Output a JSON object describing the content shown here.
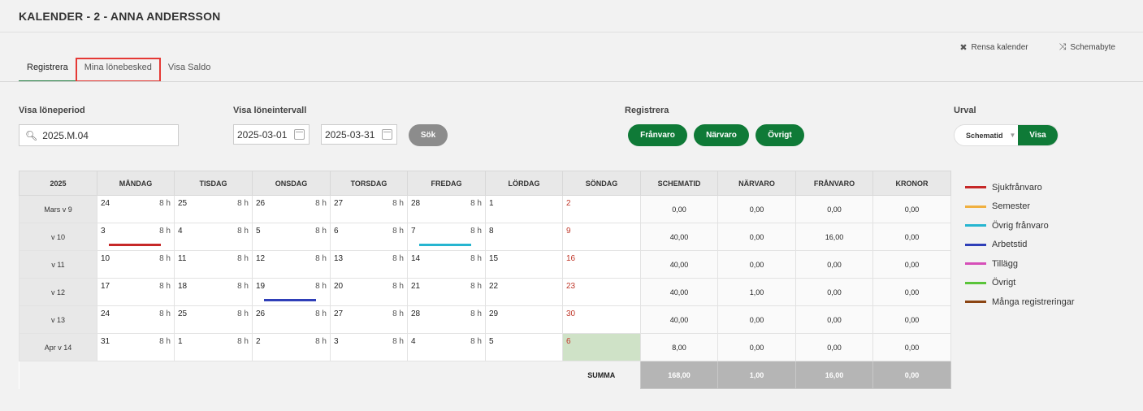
{
  "header": {
    "title": "KALENDER - 2 - ANNA ANDERSSON"
  },
  "top_actions": [
    {
      "icon": "close-icon",
      "glyph": "✖",
      "label": "Rensa kalender"
    },
    {
      "icon": "shuffle-icon",
      "glyph": "⤨",
      "label": "Schemabyte"
    }
  ],
  "tabs": [
    {
      "label": "Registrera",
      "active": true
    },
    {
      "label": "Mina lönebesked",
      "highlighted": true
    },
    {
      "label": "Visa Saldo"
    }
  ],
  "filters": {
    "period_label": "Visa löneperiod",
    "period_value": "2025.M.04",
    "interval_label": "Visa löneintervall",
    "date_from": "2025-03-01",
    "date_to": "2025-03-31",
    "search_button": "Sök",
    "register_label": "Registrera",
    "register_buttons": [
      "Frånvaro",
      "Närvaro",
      "Övrigt"
    ],
    "urval_label": "Urval",
    "urval_select": "Schematid",
    "urval_button": "Visa"
  },
  "calendar": {
    "year": "2025",
    "day_headers": [
      "MÅNDAG",
      "TISDAG",
      "ONSDAG",
      "TORSDAG",
      "FREDAG",
      "LÖRDAG",
      "SÖNDAG"
    ],
    "sum_headers": [
      "SCHEMATID",
      "NÄRVARO",
      "FRÅNVARO",
      "KRONOR"
    ],
    "weeks": [
      {
        "label": "Mars v 9",
        "days": [
          {
            "d": "24",
            "h": "8 h"
          },
          {
            "d": "25",
            "h": "8 h"
          },
          {
            "d": "26",
            "h": "8 h"
          },
          {
            "d": "27",
            "h": "8 h"
          },
          {
            "d": "28",
            "h": "8 h"
          },
          {
            "d": "1",
            "h": ""
          },
          {
            "d": "2",
            "h": ""
          }
        ],
        "sums": [
          "0,00",
          "0,00",
          "0,00",
          "0,00"
        ]
      },
      {
        "label": "v 10",
        "days": [
          {
            "d": "3",
            "h": "8 h",
            "mark": "#c62828"
          },
          {
            "d": "4",
            "h": "8 h"
          },
          {
            "d": "5",
            "h": "8 h"
          },
          {
            "d": "6",
            "h": "8 h"
          },
          {
            "d": "7",
            "h": "8 h",
            "mark": "#26b5d0"
          },
          {
            "d": "8",
            "h": ""
          },
          {
            "d": "9",
            "h": ""
          }
        ],
        "sums": [
          "40,00",
          "0,00",
          "16,00",
          "0,00"
        ]
      },
      {
        "label": "v 11",
        "days": [
          {
            "d": "10",
            "h": "8 h"
          },
          {
            "d": "11",
            "h": "8 h"
          },
          {
            "d": "12",
            "h": "8 h"
          },
          {
            "d": "13",
            "h": "8 h"
          },
          {
            "d": "14",
            "h": "8 h"
          },
          {
            "d": "15",
            "h": ""
          },
          {
            "d": "16",
            "h": ""
          }
        ],
        "sums": [
          "40,00",
          "0,00",
          "0,00",
          "0,00"
        ]
      },
      {
        "label": "v 12",
        "days": [
          {
            "d": "17",
            "h": "8 h"
          },
          {
            "d": "18",
            "h": "8 h"
          },
          {
            "d": "19",
            "h": "8 h",
            "mark": "#2f3fb8"
          },
          {
            "d": "20",
            "h": "8 h"
          },
          {
            "d": "21",
            "h": "8 h"
          },
          {
            "d": "22",
            "h": ""
          },
          {
            "d": "23",
            "h": ""
          }
        ],
        "sums": [
          "40,00",
          "1,00",
          "0,00",
          "0,00"
        ]
      },
      {
        "label": "v 13",
        "days": [
          {
            "d": "24",
            "h": "8 h"
          },
          {
            "d": "25",
            "h": "8 h"
          },
          {
            "d": "26",
            "h": "8 h"
          },
          {
            "d": "27",
            "h": "8 h"
          },
          {
            "d": "28",
            "h": "8 h"
          },
          {
            "d": "29",
            "h": ""
          },
          {
            "d": "30",
            "h": ""
          }
        ],
        "sums": [
          "40,00",
          "0,00",
          "0,00",
          "0,00"
        ]
      },
      {
        "label": "Apr v 14",
        "days": [
          {
            "d": "31",
            "h": "8 h"
          },
          {
            "d": "1",
            "h": "8 h"
          },
          {
            "d": "2",
            "h": "8 h"
          },
          {
            "d": "3",
            "h": "8 h"
          },
          {
            "d": "4",
            "h": "8 h"
          },
          {
            "d": "5",
            "h": ""
          },
          {
            "d": "6",
            "h": "",
            "green": true
          }
        ],
        "sums": [
          "8,00",
          "0,00",
          "0,00",
          "0,00"
        ]
      }
    ],
    "summa_label": "SUMMA",
    "totals": [
      "168,00",
      "1,00",
      "16,00",
      "0,00"
    ]
  },
  "legend": [
    {
      "label": "Sjukfrånvaro",
      "color": "#c62828"
    },
    {
      "label": "Semester",
      "color": "#f0b040"
    },
    {
      "label": "Övrig frånvaro",
      "color": "#26b5d0"
    },
    {
      "label": "Arbetstid",
      "color": "#2f3fb8"
    },
    {
      "label": "Tillägg",
      "color": "#d64fb8"
    },
    {
      "label": "Övrigt",
      "color": "#5ac43a"
    },
    {
      "label": "Många registreringar",
      "color": "#8b4513"
    }
  ]
}
